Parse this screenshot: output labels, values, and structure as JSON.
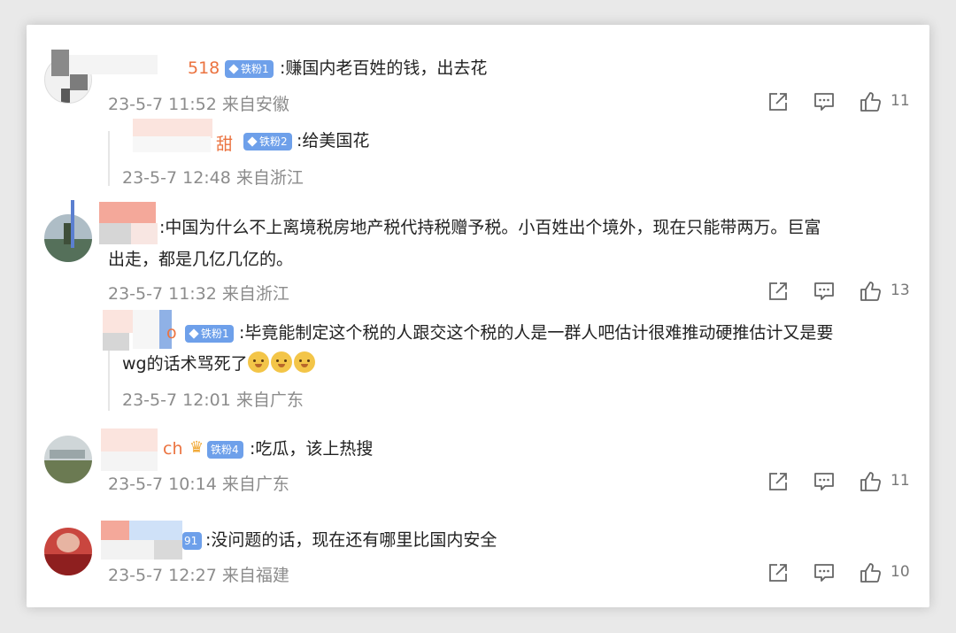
{
  "comments": [
    {
      "name_fragment": "518",
      "badge": "铁粉1",
      "text": ":赚国内老百姓的钱，出去花",
      "time": "23-5-7 11:52 来自安徽",
      "likes": "11",
      "reply": {
        "name_fragment": "甜",
        "badge": "铁粉2",
        "text": ":给美国花",
        "time": "23-5-7 12:48 来自浙江"
      }
    },
    {
      "name_fragment": "",
      "badge": "",
      "text_line1": ":中国为什么不上离境税房地产税代持税赠予税。小百姓出个境外，现在只能带两万。巨富",
      "text_line2": "出走，都是几亿几亿的。",
      "time": "23-5-7 11:32 来自浙江",
      "likes": "13",
      "reply": {
        "name_fragment": "o",
        "badge": "铁粉1",
        "text_line1": ":毕竟能制定这个税的人跟交这个税的人是一群人吧估计很难推动硬推估计又是要",
        "text_line2": "wg的话术骂死了",
        "time": "23-5-7 12:01 来自广东"
      }
    },
    {
      "name_fragment": "ch",
      "badge": "铁粉4",
      "text": ":吃瓜，该上热搜",
      "time": "23-5-7 10:14 来自广东",
      "likes": "11"
    },
    {
      "name_fragment": "",
      "badge": "91",
      "text": ":没问题的话，现在还有哪里比国内安全",
      "time": "23-5-7 12:27 来自福建",
      "likes": "10"
    }
  ],
  "icons": {
    "share": "share-icon",
    "comment": "comment-icon",
    "like": "thumbs-up-icon"
  },
  "colors": {
    "username": "#eb7340",
    "badge": "#6ea0ea",
    "meta": "#8c8c8c",
    "text": "#222222"
  }
}
